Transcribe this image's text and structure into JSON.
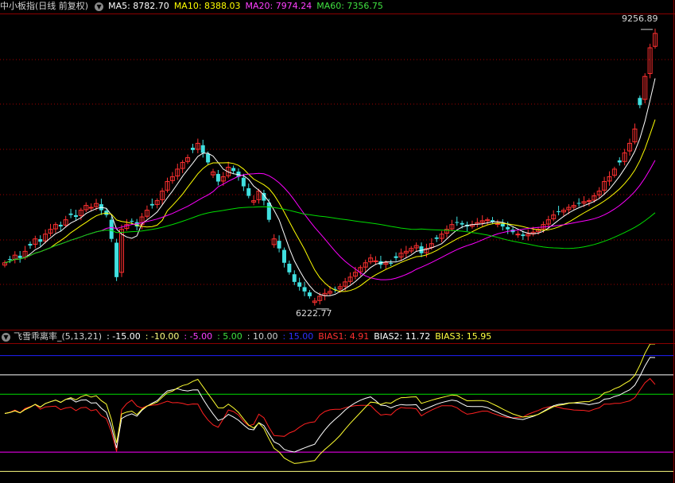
{
  "main": {
    "title": "中小板指(日线 前复权)",
    "ma5": "MA5: 8782.70",
    "ma10": "MA10: 8388.03",
    "ma20": "MA20: 7974.24",
    "ma60": "MA60: 7356.75",
    "high_label": "9256.89",
    "low_label": "6222.77"
  },
  "sub": {
    "name": "飞雪乖离率_",
    "params": "(5,13,21)",
    "lines": [
      ": -15.00",
      ": -10.00",
      ": -5.00",
      ": 5.00",
      ": 10.00",
      ": 15.00"
    ],
    "bias1": "BIAS1: 4.91",
    "bias2": "BIAS2: 11.72",
    "bias3": "BIAS3: 15.95"
  },
  "colors": {
    "up": "#ff3030",
    "down": "#40e0e0",
    "ma5": "#ffffff",
    "ma10": "#ffff00",
    "ma20": "#ff00ff",
    "ma60": "#00dd00",
    "grid": "#a00000",
    "border": "#8b0000",
    "bias1": "#ff2020",
    "bias2": "#ffffff",
    "bias3": "#ffff30"
  },
  "chart_data": [
    {
      "type": "candlestick",
      "title": "中小板指(日线 前复权)",
      "series": [
        {
          "name": "MA5",
          "last": 8782.7
        },
        {
          "name": "MA10",
          "last": 8388.03
        },
        {
          "name": "MA20",
          "last": 7974.24
        },
        {
          "name": "MA60",
          "last": 7356.75
        }
      ],
      "annotations": [
        {
          "text": "9256.89",
          "type": "high"
        },
        {
          "text": "6222.77",
          "type": "low"
        }
      ],
      "ylim": [
        6100,
        9400
      ],
      "close": [
        6800,
        6830,
        6880,
        6850,
        6920,
        6980,
        7050,
        7020,
        7100,
        7150,
        7200,
        7180,
        7250,
        7300,
        7280,
        7350,
        7400,
        7380,
        7420,
        7350,
        7300,
        7050,
        6650,
        7150,
        7200,
        7230,
        7180,
        7280,
        7350,
        7400,
        7450,
        7550,
        7650,
        7700,
        7780,
        7850,
        7900,
        7980,
        8050,
        7950,
        7850,
        7750,
        7650,
        7700,
        7800,
        7760,
        7700,
        7600,
        7500,
        7450,
        7550,
        7450,
        7250,
        7050,
        6950,
        6800,
        6700,
        6600,
        6550,
        6500,
        6450,
        6400,
        6450,
        6480,
        6500,
        6520,
        6550,
        6600,
        6650,
        6700,
        6750,
        6800,
        6850,
        6820,
        6780,
        6800,
        6790,
        6850,
        6900,
        6920,
        6950,
        6980,
        6900,
        6950,
        7000,
        7050,
        7100,
        7150,
        7200,
        7220,
        7200,
        7180,
        7200,
        7220,
        7240,
        7250,
        7230,
        7210,
        7180,
        7150,
        7120,
        7100,
        7080,
        7100,
        7120,
        7150,
        7200,
        7250,
        7300,
        7330,
        7350,
        7380,
        7400,
        7420,
        7440,
        7450,
        7500,
        7550,
        7650,
        7700,
        7780,
        7850,
        7950,
        8050,
        8200,
        8450,
        8750,
        9050,
        9200
      ],
      "sample_step": 1
    },
    {
      "type": "line",
      "title": "飞雪乖离率_(5,13,21)",
      "hlines": [
        -15,
        -10,
        -5,
        5,
        10,
        15
      ],
      "series": [
        {
          "name": "BIAS1",
          "last": 4.91
        },
        {
          "name": "BIAS2",
          "last": 11.72
        },
        {
          "name": "BIAS3",
          "last": 15.95
        }
      ],
      "ylim": [
        -18,
        18
      ]
    }
  ]
}
